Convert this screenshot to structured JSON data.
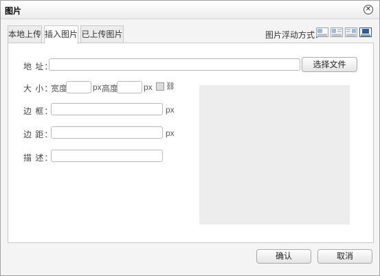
{
  "dialog": {
    "title": "图片",
    "close_glyph": "✕"
  },
  "tabs": [
    {
      "label": "本地上传",
      "active": false
    },
    {
      "label": "插入图片",
      "active": true
    },
    {
      "label": "已上传图片",
      "active": false
    }
  ],
  "float": {
    "label": "图片浮动方式：",
    "options": [
      "float-none-icon",
      "float-left-icon",
      "float-right-icon",
      "float-center-icon"
    ],
    "selected": "float-center-icon"
  },
  "form": {
    "address": {
      "label": "地 址：",
      "value": ""
    },
    "choose_file_label": "选择文件",
    "size": {
      "label": "大 小：",
      "width_label": "宽度",
      "height_label": "高度",
      "unit": "px"
    },
    "border": {
      "label": "边 框：",
      "unit": "px"
    },
    "margin": {
      "label": "边 距：",
      "unit": "px"
    },
    "description": {
      "label": "描 述：",
      "value": ""
    }
  },
  "footer": {
    "confirm_label": "确认",
    "cancel_label": "取消"
  },
  "colors": {
    "preview_bg": "#ededed",
    "selected_icon": "#2a5d9f"
  }
}
